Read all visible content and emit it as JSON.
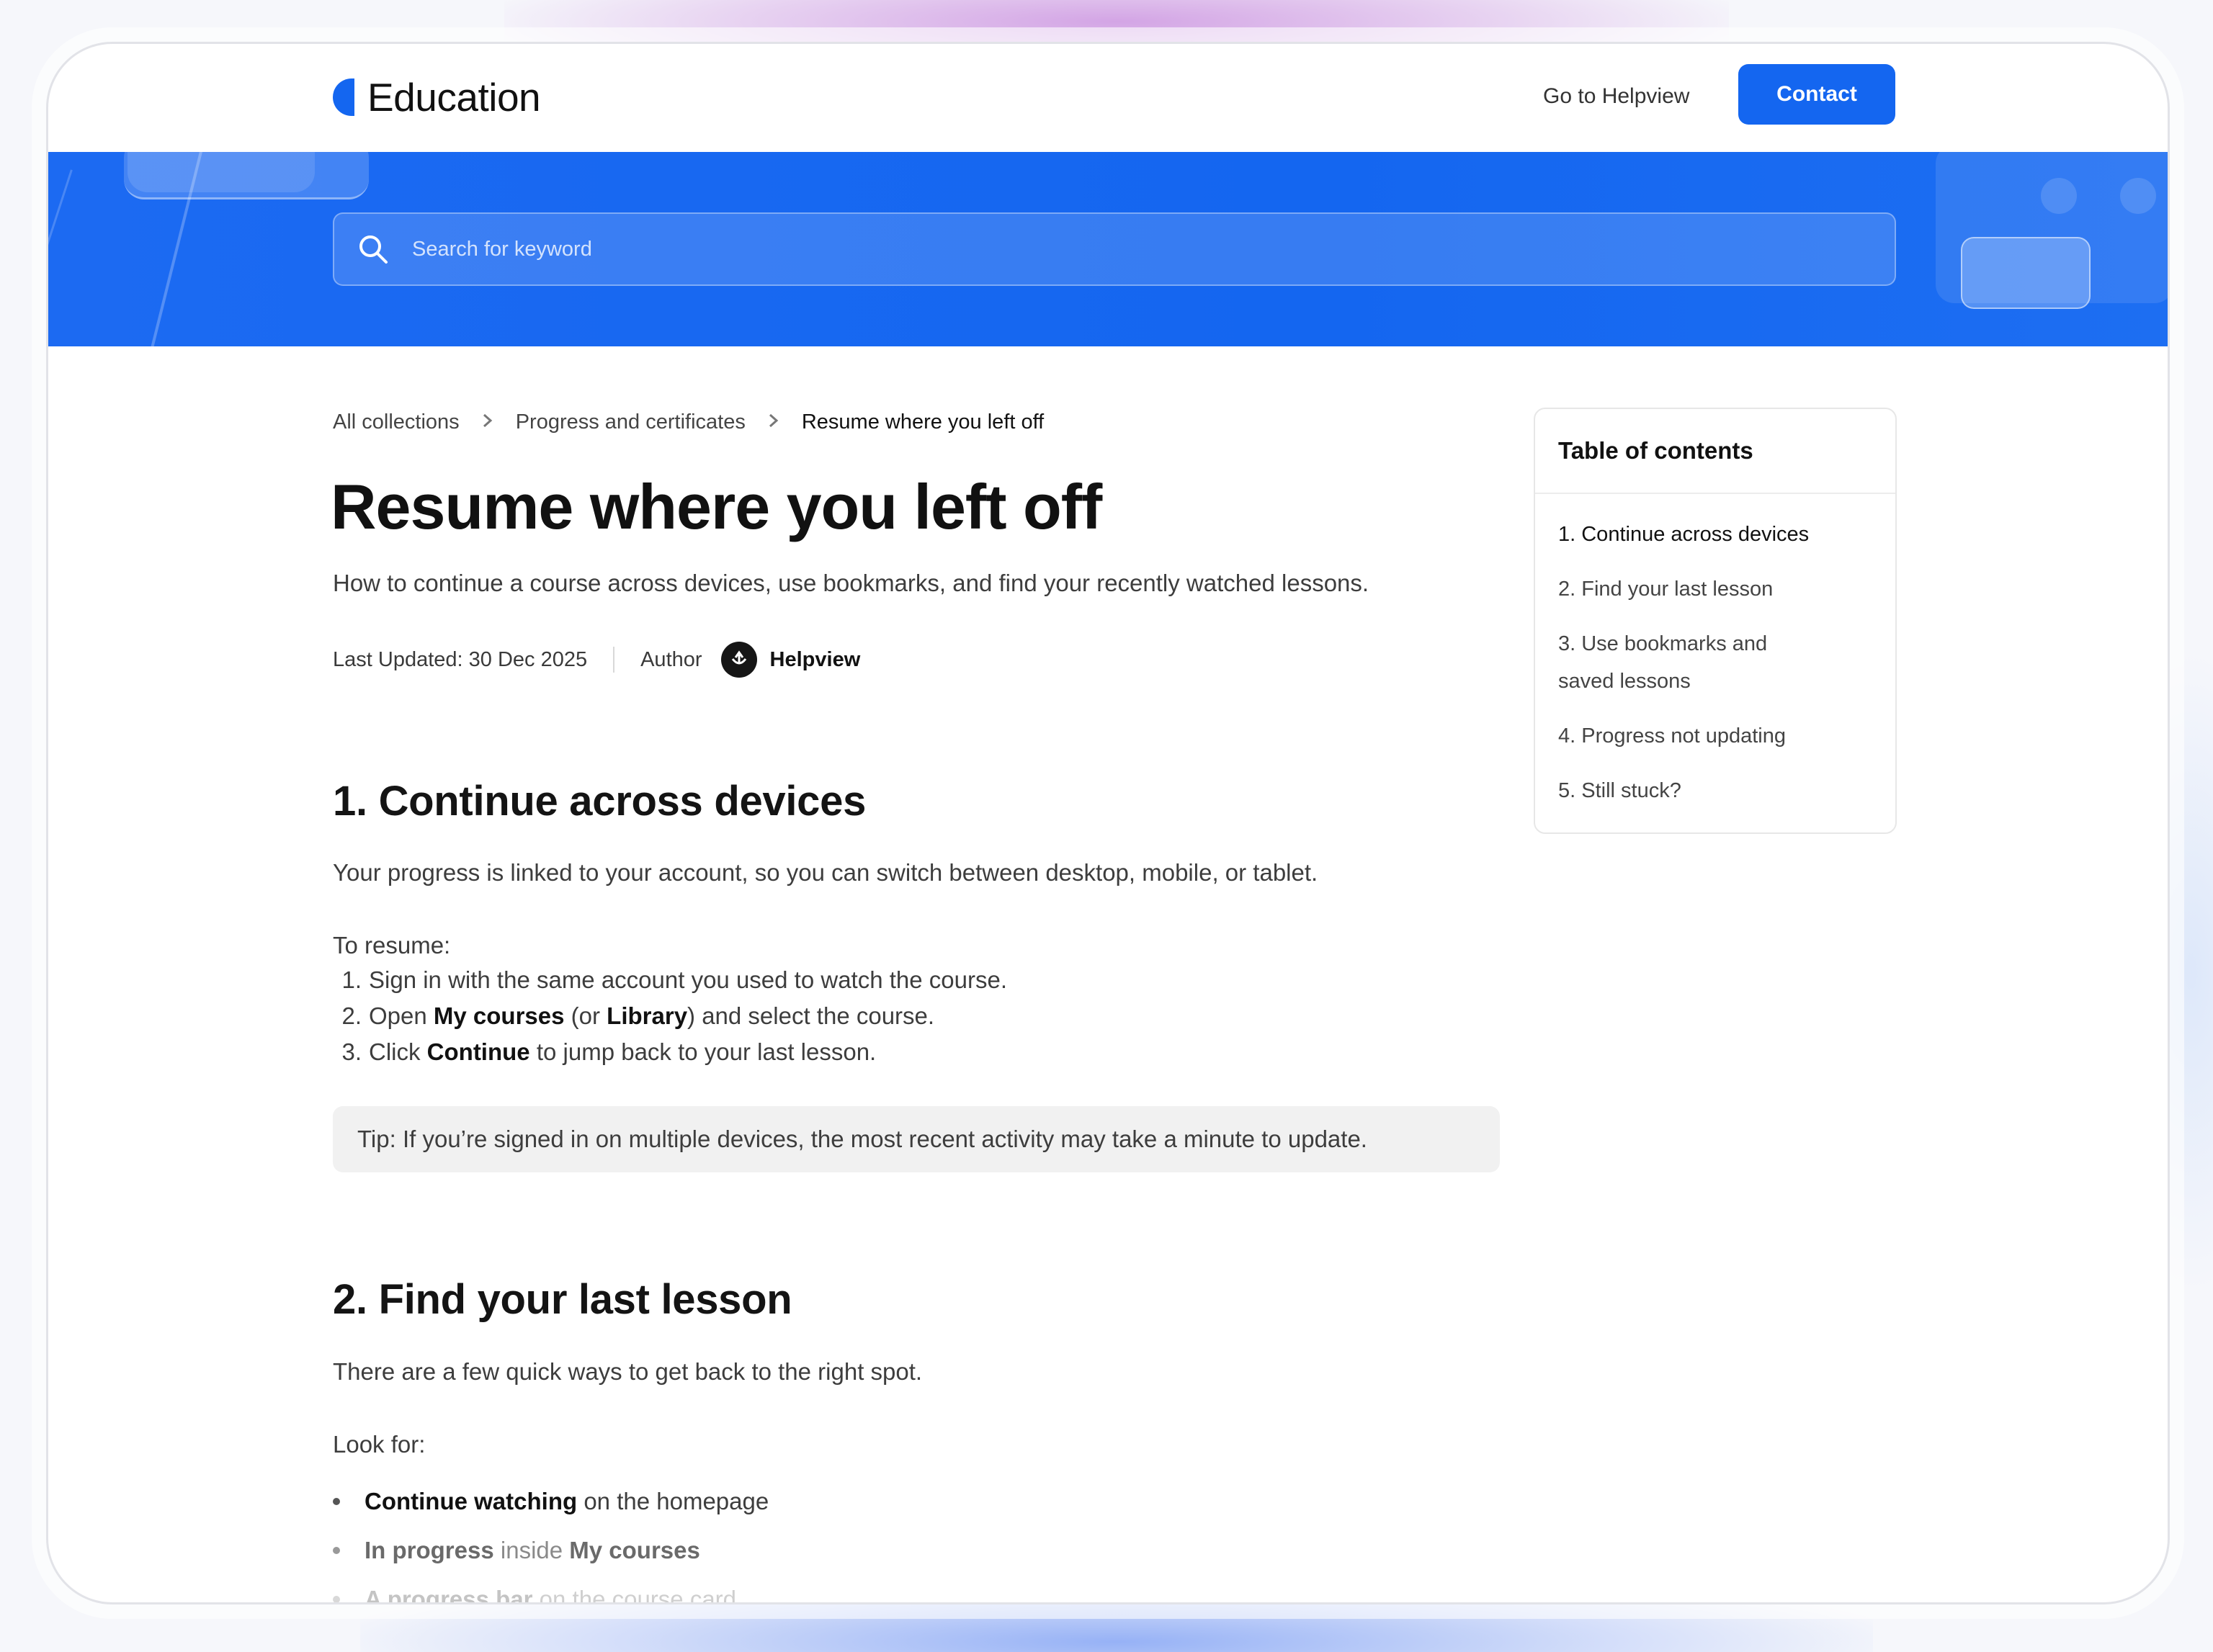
{
  "header": {
    "brand": "Education",
    "nav_link": "Go to Helpview",
    "contact_label": "Contact"
  },
  "search": {
    "placeholder": "Search for keyword",
    "icon": "search-icon"
  },
  "breadcrumb": {
    "items": [
      "All collections",
      "Progress and certificates",
      "Resume where you left off"
    ]
  },
  "article": {
    "title": "Resume where you left off",
    "subtitle": "How to continue a course across devices, use bookmarks, and find your recently watched lessons.",
    "last_updated": "Last Updated: 30 Dec 2025",
    "author_label": "Author",
    "author_name": "Helpview",
    "section1": {
      "heading": "1. Continue across devices",
      "intro": "Your progress is linked to your account, so you can switch between desktop, mobile, or tablet.",
      "lead": "To resume:",
      "steps": [
        {
          "num": "1.",
          "parts": [
            "Sign in with the same account you used to watch the course."
          ]
        },
        {
          "num": "2.",
          "before": "Open ",
          "b1": "My courses",
          "mid": " (or ",
          "b2": "Library",
          "after": ") and select the course."
        },
        {
          "num": "3.",
          "before": "Click ",
          "b1": "Continue",
          "after": " to jump back to your last lesson."
        }
      ],
      "tip": "Tip: If you’re signed in on multiple devices, the most recent activity may take a minute to update."
    },
    "section2": {
      "heading": "2. Find your last lesson",
      "intro": "There are a few quick ways to get back to the right spot.",
      "lead": "Look for:",
      "bullets": [
        {
          "bold": "Continue watching",
          "rest": " on the homepage"
        },
        {
          "bold": "In progress",
          "rest": " inside ",
          "bold2": "My courses"
        },
        {
          "bold": "A progress bar",
          "rest": " on the course card"
        }
      ]
    }
  },
  "toc": {
    "title": "Table of contents",
    "items": [
      "1. Continue across devices",
      "2. Find your last lesson",
      "3. Use bookmarks and saved lessons",
      "4. Progress not updating",
      "5. Still stuck?"
    ]
  },
  "colors": {
    "accent": "#1466f0",
    "text": "#111111"
  }
}
